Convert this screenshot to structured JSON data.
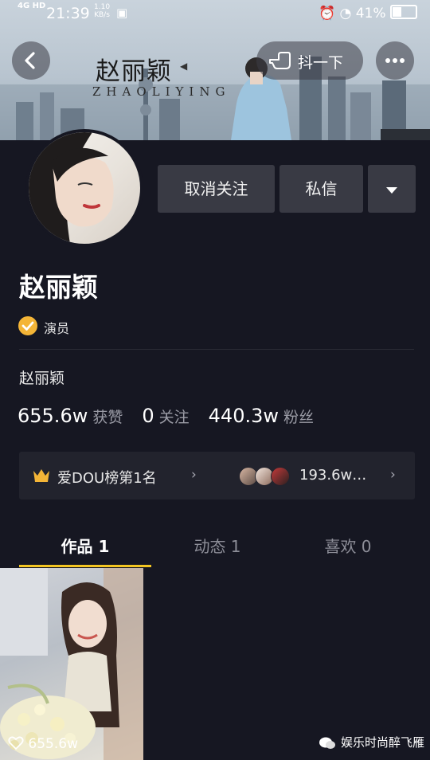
{
  "status_bar": {
    "network": "4G HD",
    "time": "21:39",
    "speed_value": "1.10",
    "speed_unit": "KB/s",
    "battery": "41%"
  },
  "banner": {
    "brand_cn": "赵丽颖",
    "brand_en": "ZHAOLIYING",
    "shake_label": "抖一下"
  },
  "actions": {
    "unfollow_label": "取消关注",
    "message_label": "私信"
  },
  "profile": {
    "name": "赵丽颖",
    "verified_label": "演员",
    "bio": "赵丽颖",
    "likes_count": "655.6w",
    "likes_label": "获赞",
    "following_count": "0",
    "following_label": "关注",
    "fans_count": "440.3w",
    "fans_label": "粉丝"
  },
  "rank": {
    "rank_label": "爱DOU榜第1名",
    "fans_value": "193.6w…"
  },
  "tabs": [
    {
      "label": "作品 1",
      "active": true
    },
    {
      "label": "动态 1",
      "active": false
    },
    {
      "label": "喜欢 0",
      "active": false
    }
  ],
  "videos": [
    {
      "likes": "655.6w"
    }
  ],
  "watermark": "娱乐时尚醉飞雁",
  "colors": {
    "background": "#161722",
    "button": "#393a44",
    "accent": "#f4c622",
    "verified": "#f4b537"
  }
}
